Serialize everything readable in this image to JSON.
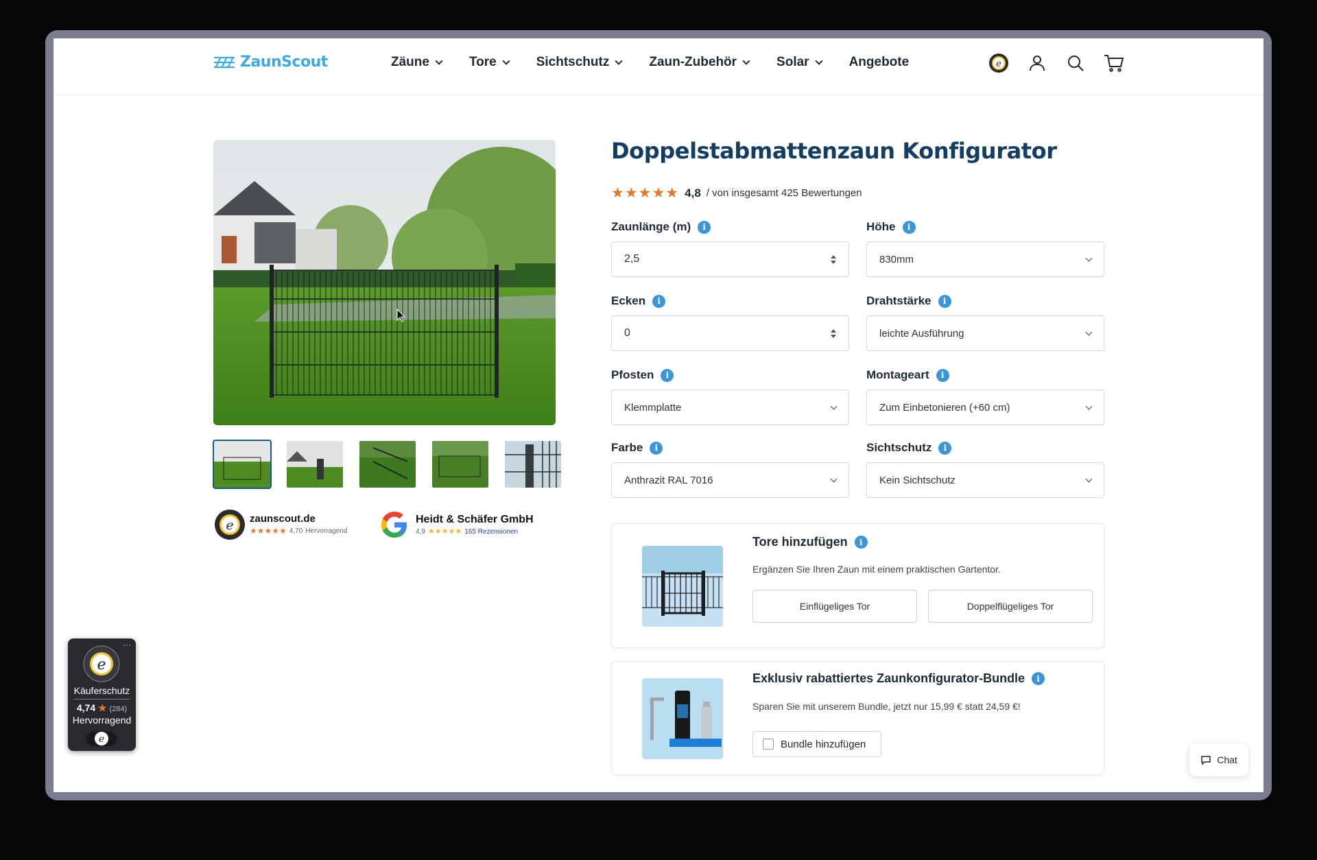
{
  "header": {
    "logo_text": "ZaunScout",
    "nav": [
      {
        "label": "Zäune",
        "has_dropdown": true
      },
      {
        "label": "Tore",
        "has_dropdown": true
      },
      {
        "label": "Sichtschutz",
        "has_dropdown": true
      },
      {
        "label": "Zaun-Zubehör",
        "has_dropdown": true
      },
      {
        "label": "Solar",
        "has_dropdown": true
      },
      {
        "label": "Angebote",
        "has_dropdown": false
      }
    ],
    "icons": [
      "trusted-shops-icon",
      "account-icon",
      "search-icon",
      "cart-icon"
    ]
  },
  "gallery": {
    "thumbnail_count": 5,
    "active_index": 0
  },
  "badges": {
    "ts_domain": "zaunscout.de",
    "ts_rating": "4,70",
    "ts_rating_label": "Hervorragend",
    "google_company": "Heidt & Schäfer GmbH",
    "google_rating": "4,9",
    "google_reviews": "165 Rezensionen"
  },
  "product": {
    "title": "Doppelstabmattenzaun Konfigurator",
    "stars": "★★★★★",
    "rating": "4,8",
    "rating_text": "/ von insgesamt 425 Bewertungen"
  },
  "fields": {
    "zaunlaenge": {
      "label": "Zaunlänge (m)",
      "value": "2,5"
    },
    "hoehe": {
      "label": "Höhe",
      "value": "830mm"
    },
    "ecken": {
      "label": "Ecken",
      "value": "0"
    },
    "drahtstaerke": {
      "label": "Drahtstärke",
      "value": "leichte Ausführung"
    },
    "pfosten": {
      "label": "Pfosten",
      "value": "Klemmplatte"
    },
    "montageart": {
      "label": "Montageart",
      "value": "Zum Einbetonieren (+60 cm)"
    },
    "farbe": {
      "label": "Farbe",
      "value": "Anthrazit RAL 7016"
    },
    "sichtschutz": {
      "label": "Sichtschutz",
      "value": "Kein Sichtschutz"
    }
  },
  "tore_card": {
    "title": "Tore hinzufügen",
    "desc": "Ergänzen Sie Ihren Zaun mit einem praktischen Gartentor.",
    "btn_single": "Einflügeliges Tor",
    "btn_double": "Doppelflügeliges Tor"
  },
  "bundle_card": {
    "title": "Exklusiv rabattiertes Zaunkonfigurator-Bundle",
    "desc": "Sparen Sie mit unserem Bundle, jetzt nur 15,99 € statt 24,59 €!",
    "checkbox_label": "Bundle hinzufügen"
  },
  "ts_widget": {
    "label": "Käuferschutz",
    "rating": "4,74",
    "count": "(284)",
    "text": "Hervorragend",
    "dots": "···"
  },
  "chat": {
    "label": "Chat"
  },
  "colors": {
    "title": "#143d63",
    "accent": "#3c95d6",
    "star": "#e37a2b",
    "logo": "#3fa9dc"
  }
}
